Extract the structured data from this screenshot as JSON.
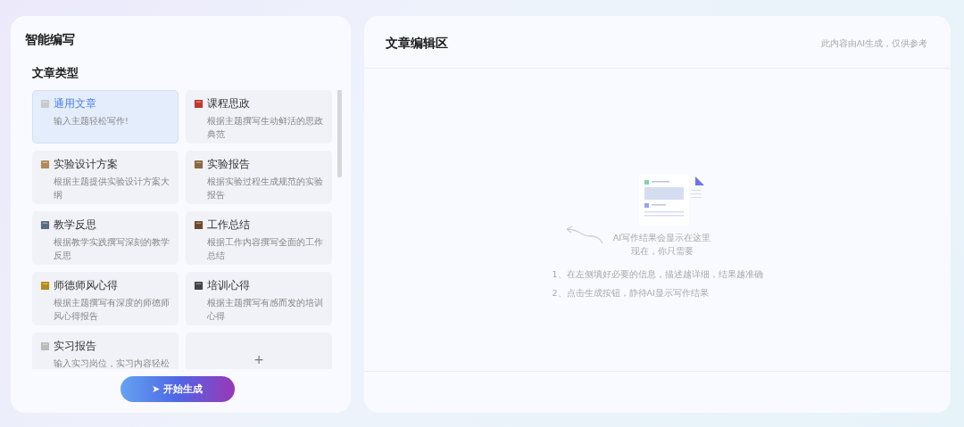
{
  "left_panel": {
    "title": "智能编写",
    "section_title": "文章类型",
    "types": [
      {
        "title": "通用文章",
        "desc": "输入主题轻松写作!",
        "selected": true
      },
      {
        "title": "课程思政",
        "desc": "根据主题撰写生动鲜活的思政典范",
        "selected": false
      },
      {
        "title": "实验设计方案",
        "desc": "根据主题提供实验设计方案大纲",
        "selected": false
      },
      {
        "title": "实验报告",
        "desc": "根据实验过程生成规范的实验报告",
        "selected": false
      },
      {
        "title": "教学反思",
        "desc": "根据教学实践撰写深刻的教学反思",
        "selected": false
      },
      {
        "title": "工作总结",
        "desc": "根据工作内容撰写全面的工作总结",
        "selected": false
      },
      {
        "title": "师德师风心得",
        "desc": "根据主题撰写有深度的师德师风心得报告",
        "selected": false
      },
      {
        "title": "培训心得",
        "desc": "根据主题撰写有感而发的培训心得",
        "selected": false
      },
      {
        "title": "实习报告",
        "desc": "输入实习岗位，实习内容轻松",
        "selected": false
      }
    ],
    "add_label": "+",
    "generate_button": "➤ 开始生成"
  },
  "editor": {
    "title": "文章编辑区",
    "notice": "此内容由AI生成，仅供参考",
    "empty_title": "AI写作结果会显示在这里",
    "empty_subtitle": "现在，你只需要",
    "steps": [
      "1、在左侧填好必要的信息，描述越详细，结果越准确",
      "2、点击生成按钮，静待AI显示写作结果"
    ]
  }
}
